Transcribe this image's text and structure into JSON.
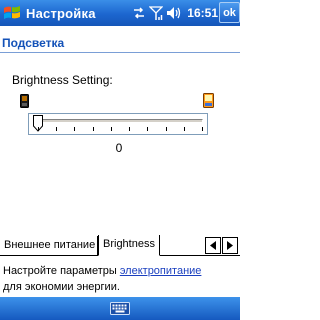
{
  "titlebar": {
    "start_icon": "windows-flag-icon",
    "title": "Настройка",
    "tray_icons": [
      "connectivity-icon",
      "signal-icon",
      "volume-icon"
    ],
    "clock": "16:51",
    "ok_label": "ok"
  },
  "section": {
    "title": "Подсветка"
  },
  "brightness": {
    "label": "Brightness Setting:",
    "value": "0",
    "level": 0,
    "min_icon": "dim-phone-icon",
    "max_icon": "bright-phone-icon"
  },
  "tabs": [
    {
      "label": "Внешнее питание",
      "active": false
    },
    {
      "label": "Brightness",
      "active": true
    }
  ],
  "info": {
    "text_before": "Настройте параметры ",
    "link": "электропитание",
    "text_after": "для экономии энергии."
  },
  "menubar": {
    "center_icon": "keyboard-icon"
  },
  "colors": {
    "title_bar": "#1c66cf",
    "section_title": "#1452b8",
    "link": "#1a3fbf"
  }
}
